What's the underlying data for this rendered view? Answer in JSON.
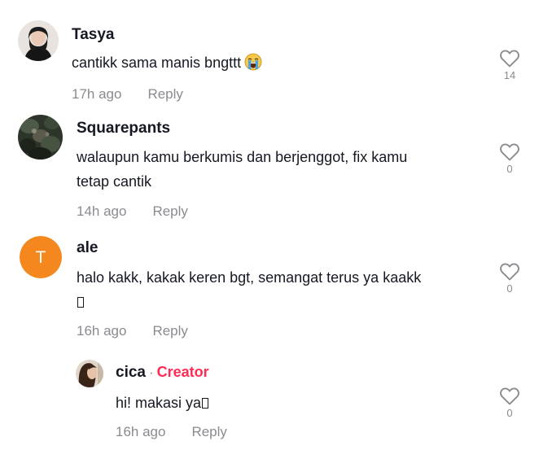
{
  "comments": [
    {
      "author": "Tasya",
      "text": "cantikk sama manis bngttt",
      "emoji": "loudly-crying-face",
      "time": "17h ago",
      "reply_label": "Reply",
      "likes": "14"
    },
    {
      "author": "Squarepants",
      "text_line1": "walaupun kamu berkumis dan berjenggot, fix kamu",
      "text_line2": "tetap cantik",
      "time": "14h ago",
      "reply_label": "Reply",
      "likes": "0"
    },
    {
      "author": "ale",
      "avatar_initial": "T",
      "avatar_color": "#f5871f",
      "text_line1": "halo kakk, kakak keren bgt, semangat terus ya kaakk",
      "time": "16h ago",
      "reply_label": "Reply",
      "likes": "0"
    }
  ],
  "reply": {
    "author": "cica",
    "separator": "·",
    "creator_label": "Creator",
    "creator_color": "#fe2c55",
    "text": "hi! makasi ya",
    "time": "16h ago",
    "reply_label": "Reply",
    "likes": "0"
  },
  "icons": {
    "like": "heart-outline-icon",
    "missing_glyph": "missing-glyph-box"
  }
}
